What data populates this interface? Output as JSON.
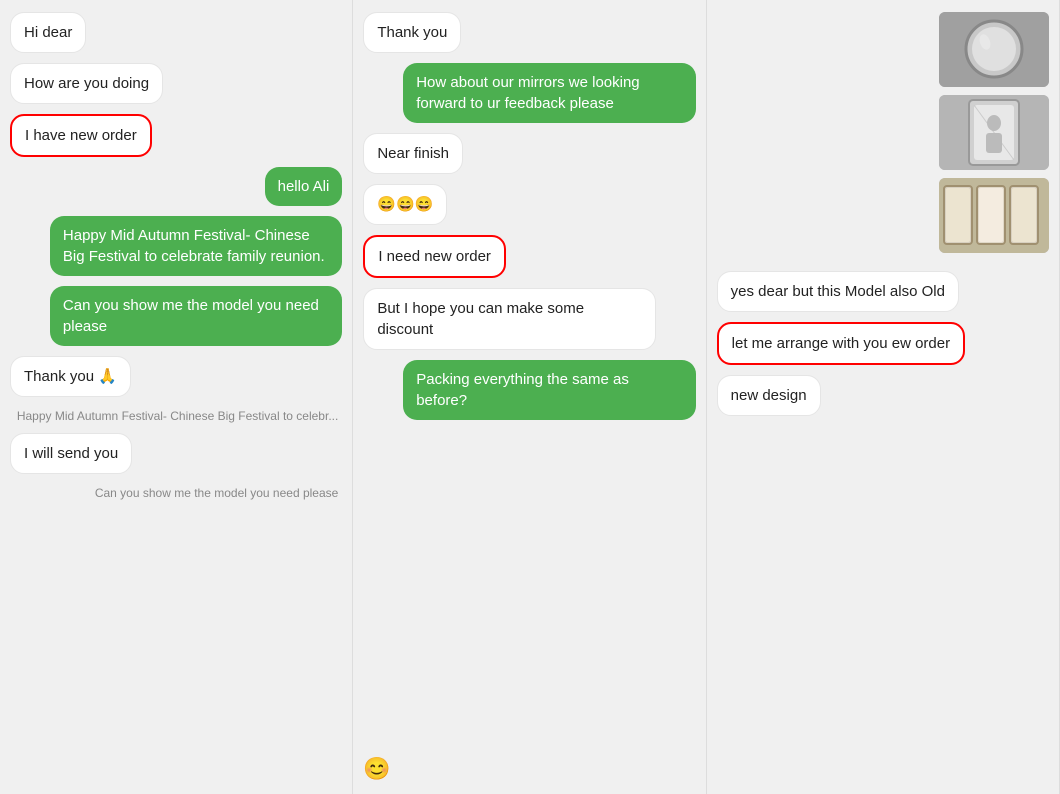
{
  "col1": {
    "messages": [
      {
        "id": "hi-dear",
        "text": "Hi dear",
        "side": "left",
        "outline": false
      },
      {
        "id": "how-are-you",
        "text": "How are you doing",
        "side": "left",
        "outline": false
      },
      {
        "id": "i-have-new-order",
        "text": "I have new order",
        "side": "left",
        "outline": true
      },
      {
        "id": "hello-ali",
        "text": "hello Ali",
        "side": "right",
        "outline": false
      },
      {
        "id": "happy-mid",
        "text": "Happy Mid Autumn Festival- Chinese Big Festival to celebrate family reunion.",
        "side": "right",
        "outline": false
      },
      {
        "id": "can-you-show",
        "text": "Can you show me the model you need please",
        "side": "right",
        "outline": false
      },
      {
        "id": "thank-you",
        "text": "Thank you 🙏",
        "side": "left",
        "outline": false
      },
      {
        "id": "preview-happy",
        "text": "Happy Mid Autumn Festival- Chinese Big Festival to celebr...",
        "side": "preview",
        "outline": false
      },
      {
        "id": "i-will-send",
        "text": "I will send you",
        "side": "left",
        "outline": false
      },
      {
        "id": "preview-can",
        "text": "Can you show me the model you need please",
        "side": "preview",
        "outline": false
      }
    ]
  },
  "col2": {
    "messages": [
      {
        "id": "thank-you2",
        "text": "Thank you",
        "side": "left",
        "outline": false
      },
      {
        "id": "how-about-mirrors",
        "text": "How about our mirrors we looking forward to ur feedback please",
        "side": "right",
        "outline": false
      },
      {
        "id": "near-finish",
        "text": "Near finish",
        "side": "left",
        "outline": false
      },
      {
        "id": "emoji-faces",
        "text": "😄😄😄",
        "side": "left",
        "outline": false
      },
      {
        "id": "i-need-new-order",
        "text": "I need new order",
        "side": "left",
        "outline": true
      },
      {
        "id": "but-hope",
        "text": "But I hope you can make some discount",
        "side": "left",
        "outline": false
      },
      {
        "id": "packing",
        "text": "Packing everything the same as before?",
        "side": "right",
        "outline": false
      }
    ],
    "input_icon": "😊"
  },
  "col3": {
    "messages": [
      {
        "id": "yes-dear",
        "text": "yes dear but this Model also Old",
        "side": "left",
        "outline": false
      },
      {
        "id": "let-me-arrange",
        "text": "let me arrange with you ew order",
        "side": "left",
        "outline": true
      },
      {
        "id": "new-design",
        "text": "new design",
        "side": "left",
        "outline": false
      }
    ],
    "images": [
      {
        "id": "img1",
        "desc": "mirror round"
      },
      {
        "id": "img2",
        "desc": "mirror tall"
      },
      {
        "id": "img3",
        "desc": "mirror collection"
      }
    ]
  }
}
